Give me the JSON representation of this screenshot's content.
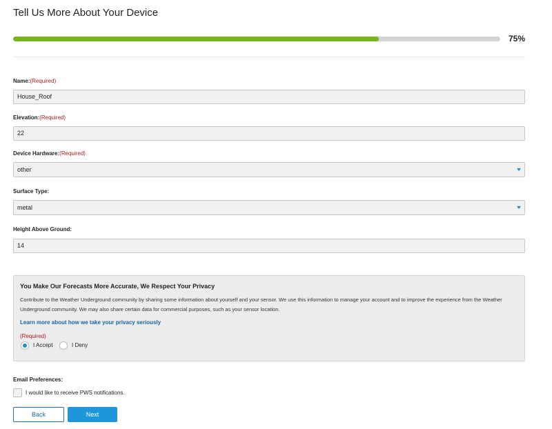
{
  "page": {
    "title": "Tell Us More About Your Device"
  },
  "progress": {
    "value_fraction": 0.75,
    "label": "75%",
    "fill_color": "#78b41c"
  },
  "fields": {
    "name": {
      "label": "Name:",
      "required": "(Required)",
      "value": "House_Roof"
    },
    "elevation": {
      "label": "Elevation:",
      "required": "(Required)",
      "value": "22"
    },
    "hardware": {
      "label": "Device Hardware:",
      "required": "(Required)",
      "value": "other"
    },
    "surface": {
      "label": "Surface Type:",
      "value": "metal"
    },
    "height": {
      "label": "Height Above Ground:",
      "value": "14"
    }
  },
  "privacy": {
    "title": "You Make Our Forecasts More Accurate, We Respect Your Privacy",
    "body": "Contribute to the Weather Underground community by sharing some information about yourself and your sensor. We use this information to manage your account and to improve the experience from the Weather Underground community. We may also share certain data for commercial purposes, such as your sensor location.",
    "link": "Learn more about how we take your privacy seriously",
    "required": "(Required)",
    "accept_label": "I Accept",
    "deny_label": "I Deny",
    "selected": "accept"
  },
  "email": {
    "label": "Email Preferences:",
    "checkbox_label": "I would like to receive PWS notifications.",
    "checked": false
  },
  "buttons": {
    "back": "Back",
    "next": "Next"
  },
  "colors": {
    "accent": "#1d97d9",
    "required": "#b01c1c",
    "link": "#1565a8"
  }
}
